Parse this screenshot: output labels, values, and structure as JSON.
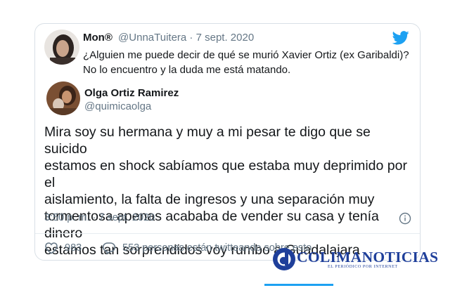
{
  "quoted_tweet": {
    "display_name": "Mon®",
    "handle_date": "@UnnaTuitera · 7 sept. 2020",
    "text_line1": "¿Alguien me puede decir de qué se murió Xavier Ortiz (ex Garibaldi)?",
    "text_line2": "No lo encuentro y la duda me está matando.",
    "avatar_icon": "user-avatar-icon"
  },
  "tweet": {
    "display_name": "Olga Ortiz Ramirez",
    "handle": "@quimicaolga",
    "text_lines": [
      "Mira soy su hermana y muy a mi pesar te digo que se suicido",
      "estamos en shock sabíamos que estaba muy deprimido por el",
      "aislamiento, la falta de ingresos y una separación muy",
      "tormentosa apenas acababa de vender su casa y tenía dinero",
      "estamos tan sorprendidos voy rumbo a Guadalajara"
    ],
    "timestamp": "3:50 p. m. · 7 sept. 2020"
  },
  "actions": {
    "likes": "983",
    "replies_text": "553 personas están twitteando sobre esto"
  },
  "watermark": {
    "name": "COLIMANOTICIAS",
    "tagline": "EL PERIÓDICO POR INTERNET"
  },
  "colors": {
    "twitter_blue": "#1da1f2",
    "brand_blue": "#1f3f9a",
    "secondary_text": "#657786"
  }
}
